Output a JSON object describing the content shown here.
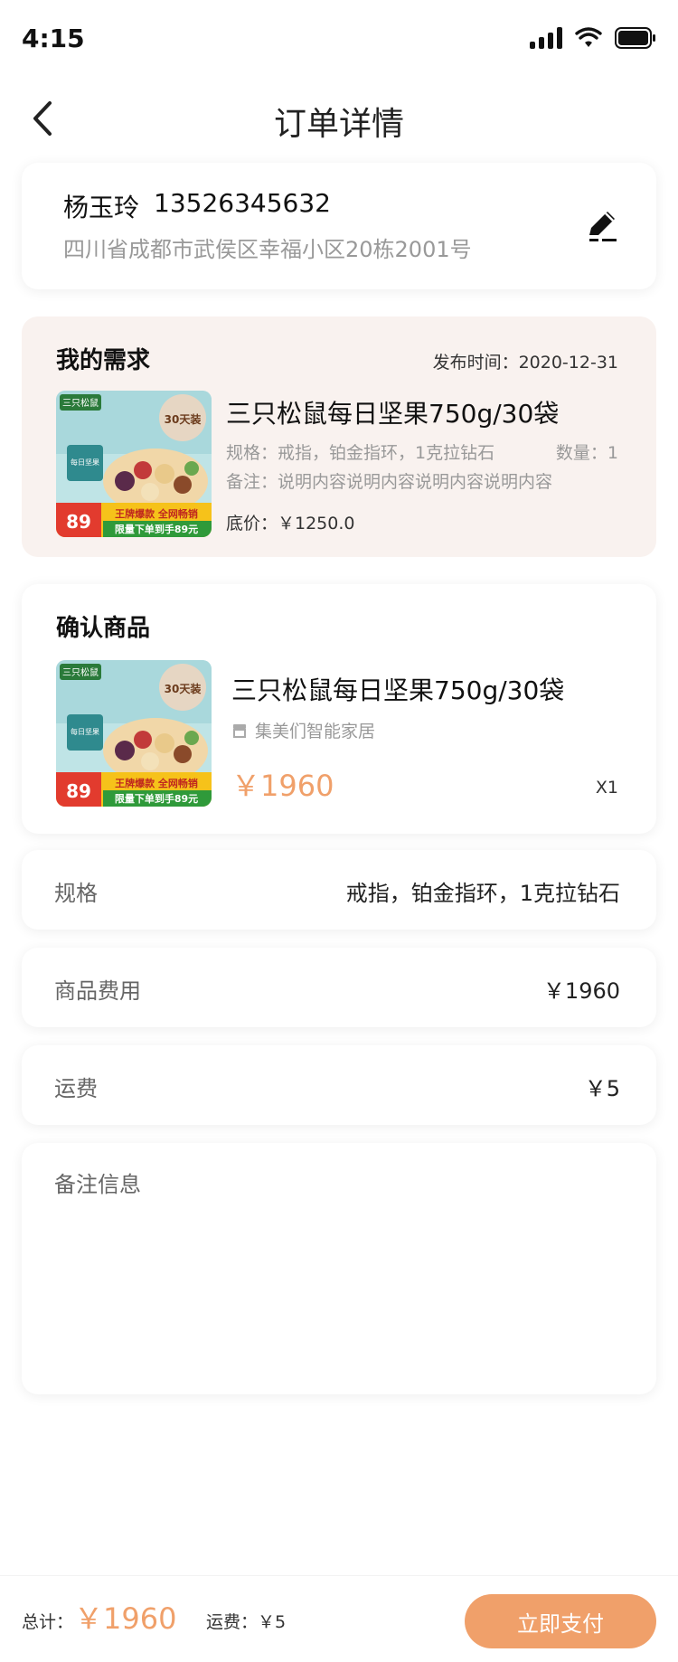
{
  "status_bar": {
    "time": "4:15"
  },
  "nav": {
    "title": "订单详情",
    "back_icon": "chevron-left-icon"
  },
  "address": {
    "name": "杨玉玲",
    "phone": "13526345632",
    "detail": "四川省成都市武侯区幸福小区20栋2001号",
    "edit_icon": "edit-pen-icon"
  },
  "demand": {
    "title": "我的需求",
    "publish_time": "发布时间：2020-12-31",
    "product_name": "三只松鼠每日坚果750g/30袋",
    "spec": "规格：戒指，铂金指环，1克拉钻石",
    "quantity": "数量：1",
    "remark": "备注：说明内容说明内容说明内容说明内容",
    "base_price": "底价：￥1250.0"
  },
  "product_image": {
    "brand": "三只松鼠",
    "box_text": "每日坚果",
    "badge": "30天装",
    "price_tag": "89",
    "banner_top": "王牌爆款 全网畅销",
    "banner_bottom": "限量下单到手89元"
  },
  "goods": {
    "title": "确认商品",
    "product_name": "三只松鼠每日坚果750g/30袋",
    "shop_name": "集美们智能家居",
    "shop_icon": "store-icon",
    "price": "￥1960",
    "quantity": "X1"
  },
  "rows": {
    "spec_label": "规格",
    "spec_value": "戒指，铂金指环，1克拉钻石",
    "fee_label": "商品费用",
    "fee_value": "￥1960",
    "ship_label": "运费",
    "ship_value": "￥5"
  },
  "remark": {
    "label": "备注信息"
  },
  "bottom": {
    "total_label": "总计：",
    "total_value": "￥1960",
    "ship_text": "运费：￥5",
    "pay_label": "立即支付"
  },
  "colors": {
    "accent": "#f0a06a",
    "demand_bg": "#f9f2ef"
  }
}
